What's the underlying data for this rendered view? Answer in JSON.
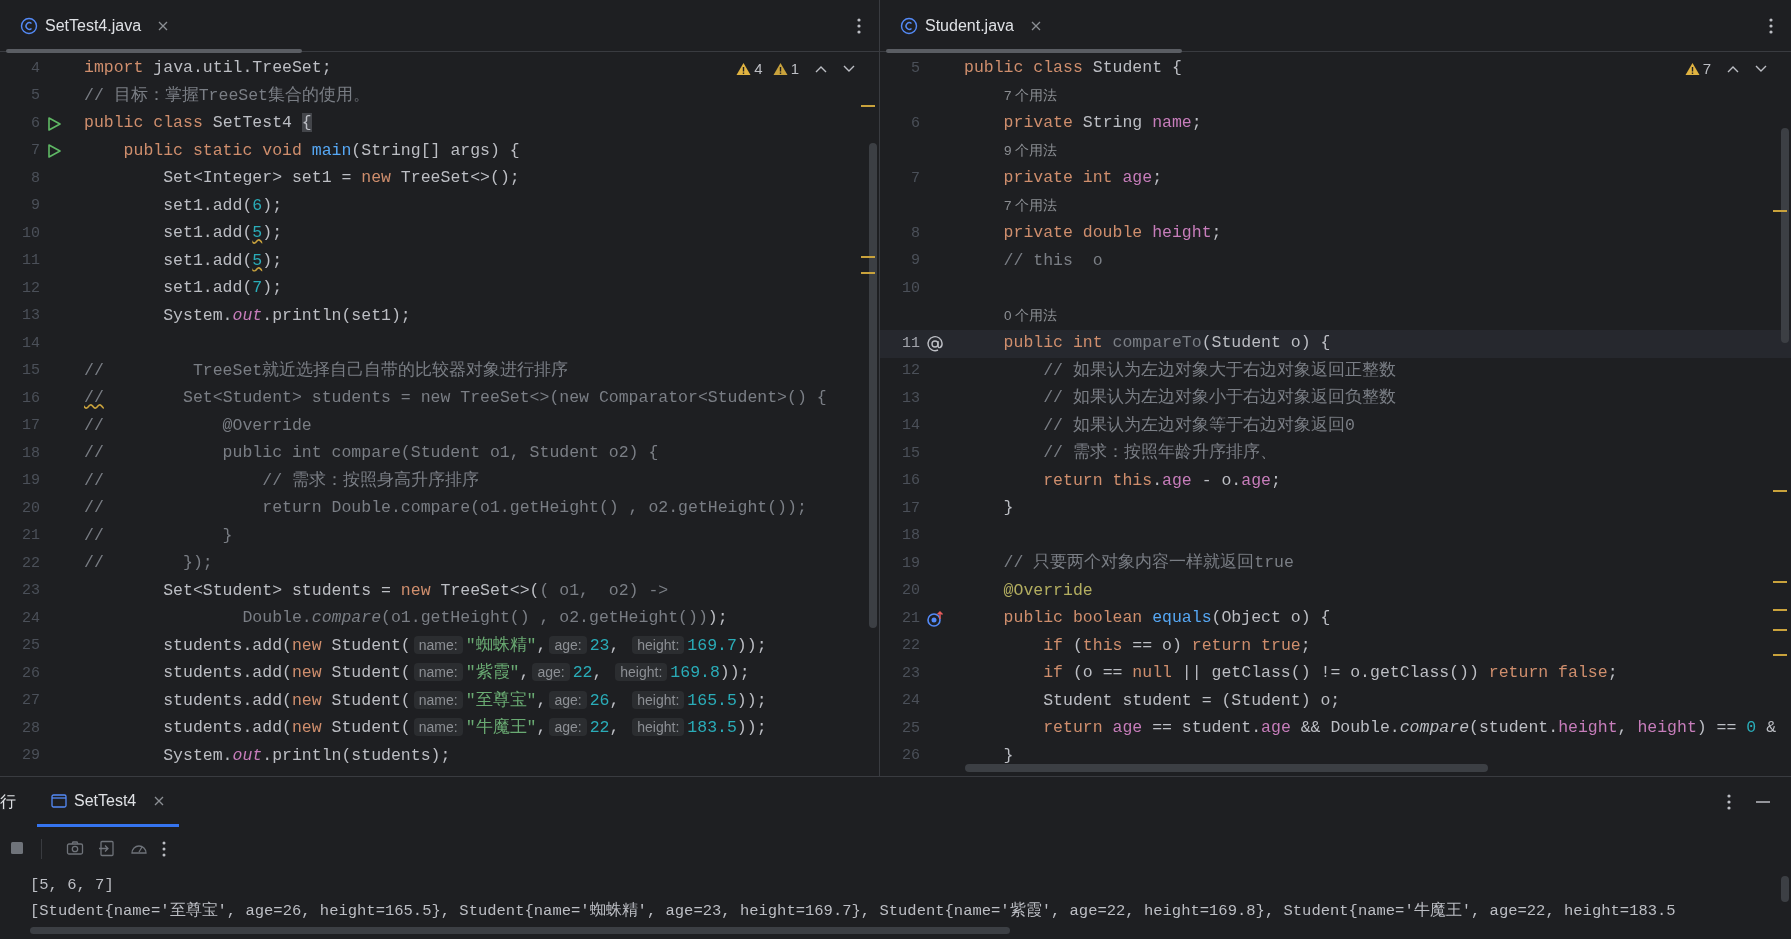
{
  "editors": [
    {
      "tab": {
        "title": "SetTest4.java",
        "selected": true
      },
      "problems": [
        {
          "kind": "warning",
          "count": "4"
        },
        {
          "kind": "weak",
          "count": "1"
        }
      ],
      "lines": [
        {
          "num": "4",
          "tokens": [
            {
              "text": "import",
              "kind": "kw"
            },
            {
              "text": " java.util.TreeSet;",
              "kind": "p"
            }
          ]
        },
        {
          "num": "5",
          "tokens": [
            {
              "text": "// 目标：掌握TreeSet集合的使用。",
              "kind": "cm"
            }
          ]
        },
        {
          "num": "6",
          "gutter_icon": {
            "kind": "run"
          },
          "tokens": [
            {
              "text": "public class",
              "kind": "kw"
            },
            {
              "text": " SetTest4 ",
              "kind": "p"
            },
            {
              "text": "{",
              "kind": "match"
            }
          ]
        },
        {
          "num": "7",
          "gutter_icon": {
            "kind": "run"
          },
          "tokens": [
            {
              "text": "    public static void ",
              "kind": "kw"
            },
            {
              "text": "main",
              "kind": "fn"
            },
            {
              "text": "(String[] args) {",
              "kind": "p"
            }
          ]
        },
        {
          "num": "8",
          "tokens": [
            {
              "text": "        Set<Integer> set1 = ",
              "kind": "p"
            },
            {
              "text": "new",
              "kind": "kw"
            },
            {
              "text": " TreeSet<>();",
              "kind": "p"
            }
          ]
        },
        {
          "num": "9",
          "tokens": [
            {
              "text": "        set1.add(",
              "kind": "p"
            },
            {
              "text": "6",
              "kind": "num"
            },
            {
              "text": ");",
              "kind": "p"
            }
          ]
        },
        {
          "num": "10",
          "tokens": [
            {
              "text": "        set1.add(",
              "kind": "p"
            },
            {
              "text": "5",
              "kind": "numwarn"
            },
            {
              "text": ");",
              "kind": "p"
            }
          ]
        },
        {
          "num": "11",
          "tokens": [
            {
              "text": "        set1.add(",
              "kind": "p"
            },
            {
              "text": "5",
              "kind": "numwarn"
            },
            {
              "text": ");",
              "kind": "p"
            }
          ]
        },
        {
          "num": "12",
          "tokens": [
            {
              "text": "        set1.add(",
              "kind": "p"
            },
            {
              "text": "7",
              "kind": "num"
            },
            {
              "text": ");",
              "kind": "p"
            }
          ]
        },
        {
          "num": "13",
          "tokens": [
            {
              "text": "        System.",
              "kind": "p"
            },
            {
              "text": "out",
              "kind": "st"
            },
            {
              "text": ".println(set1);",
              "kind": "p"
            }
          ]
        },
        {
          "num": "14"
        },
        {
          "num": "15",
          "tokens": [
            {
              "text": "//         TreeSet就近选择自己自带的比较器对象进行排序",
              "kind": "cm"
            }
          ]
        },
        {
          "num": "16",
          "tokens": [
            {
              "text": "//",
              "kind": "cmwarn"
            },
            {
              "text": "        Set<Student> students = new TreeSet<>(new Comparator<Student>() {",
              "kind": "cm"
            }
          ]
        },
        {
          "num": "17",
          "tokens": [
            {
              "text": "//            @Override",
              "kind": "cm"
            }
          ]
        },
        {
          "num": "18",
          "tokens": [
            {
              "text": "//            public int compare(Student o1, Student o2) {",
              "kind": "cm"
            }
          ]
        },
        {
          "num": "19",
          "tokens": [
            {
              "text": "//                // 需求：按照身高升序排序",
              "kind": "cm"
            }
          ]
        },
        {
          "num": "20",
          "tokens": [
            {
              "text": "//                return Double.compare(o1.getHeight() , o2.getHeight());",
              "kind": "cm"
            }
          ]
        },
        {
          "num": "21",
          "tokens": [
            {
              "text": "//            }",
              "kind": "cm"
            }
          ]
        },
        {
          "num": "22",
          "tokens": [
            {
              "text": "//        });",
              "kind": "cm"
            }
          ]
        },
        {
          "num": "23",
          "tokens": [
            {
              "text": "        Set<Student> students = ",
              "kind": "p"
            },
            {
              "text": "new",
              "kind": "kw"
            },
            {
              "text": " TreeSet<>(",
              "kind": "p"
            },
            {
              "text": "( o1,  o2) ->",
              "kind": "dim"
            }
          ]
        },
        {
          "num": "24",
          "tokens": [
            {
              "text": "                Double.",
              "kind": "dim"
            },
            {
              "text": "compare",
              "kind": "dimit"
            },
            {
              "text": "(o1.getHeight() , o2.getHeight())",
              "kind": "dim"
            },
            {
              "text": ");",
              "kind": "p"
            }
          ]
        },
        {
          "num": "25",
          "tokens": [
            {
              "text": "        students.add(",
              "kind": "p"
            },
            {
              "text": "new",
              "kind": "kw"
            },
            {
              "text": " Student(",
              "kind": "p"
            },
            {
              "text": "name:",
              "kind": "hint"
            },
            {
              "text": "\"蜘蛛精\"",
              "kind": "str"
            },
            {
              "text": ",",
              "kind": "p"
            },
            {
              "text": "age:",
              "kind": "hint"
            },
            {
              "text": "23",
              "kind": "num"
            },
            {
              "text": ", ",
              "kind": "p"
            },
            {
              "text": "height:",
              "kind": "hint"
            },
            {
              "text": "169.7",
              "kind": "num"
            },
            {
              "text": "));",
              "kind": "p"
            }
          ]
        },
        {
          "num": "26",
          "tokens": [
            {
              "text": "        students.add(",
              "kind": "p"
            },
            {
              "text": "new",
              "kind": "kw"
            },
            {
              "text": " Student(",
              "kind": "p"
            },
            {
              "text": "name:",
              "kind": "hint"
            },
            {
              "text": "\"紫霞\"",
              "kind": "str"
            },
            {
              "text": ",",
              "kind": "p"
            },
            {
              "text": "age:",
              "kind": "hint"
            },
            {
              "text": "22",
              "kind": "num"
            },
            {
              "text": ", ",
              "kind": "p"
            },
            {
              "text": "height:",
              "kind": "hint"
            },
            {
              "text": "169.8",
              "kind": "num"
            },
            {
              "text": "));",
              "kind": "p"
            }
          ]
        },
        {
          "num": "27",
          "tokens": [
            {
              "text": "        students.add(",
              "kind": "p"
            },
            {
              "text": "new",
              "kind": "kw"
            },
            {
              "text": " Student(",
              "kind": "p"
            },
            {
              "text": "name:",
              "kind": "hint"
            },
            {
              "text": "\"至尊宝\"",
              "kind": "str"
            },
            {
              "text": ",",
              "kind": "p"
            },
            {
              "text": "age:",
              "kind": "hint"
            },
            {
              "text": "26",
              "kind": "num"
            },
            {
              "text": ", ",
              "kind": "p"
            },
            {
              "text": "height:",
              "kind": "hint"
            },
            {
              "text": "165.5",
              "kind": "num"
            },
            {
              "text": "));",
              "kind": "p"
            }
          ]
        },
        {
          "num": "28",
          "tokens": [
            {
              "text": "        students.add(",
              "kind": "p"
            },
            {
              "text": "new",
              "kind": "kw"
            },
            {
              "text": " Student(",
              "kind": "p"
            },
            {
              "text": "name:",
              "kind": "hint"
            },
            {
              "text": "\"牛魔王\"",
              "kind": "str"
            },
            {
              "text": ",",
              "kind": "p"
            },
            {
              "text": "age:",
              "kind": "hint"
            },
            {
              "text": "22",
              "kind": "num"
            },
            {
              "text": ", ",
              "kind": "p"
            },
            {
              "text": "height:",
              "kind": "hint"
            },
            {
              "text": "183.5",
              "kind": "num"
            },
            {
              "text": "));",
              "kind": "p"
            }
          ]
        },
        {
          "num": "29",
          "tokens": [
            {
              "text": "        System.",
              "kind": "p"
            },
            {
              "text": "out",
              "kind": "st"
            },
            {
              "text": ".println(students);",
              "kind": "p"
            }
          ]
        }
      ]
    },
    {
      "tab": {
        "title": "Student.java",
        "selected": true
      },
      "problems": [
        {
          "kind": "warning",
          "count": "7"
        }
      ],
      "lines": [
        {
          "num": "5",
          "tokens": [
            {
              "text": "public class",
              "kind": "kw"
            },
            {
              "text": " Student {",
              "kind": "p"
            }
          ]
        },
        {
          "kind": "usages",
          "text": "7 个用法"
        },
        {
          "num": "6",
          "tokens": [
            {
              "text": "    private",
              "kind": "kw"
            },
            {
              "text": " String ",
              "kind": "p"
            },
            {
              "text": "name",
              "kind": "fld"
            },
            {
              "text": ";",
              "kind": "p"
            }
          ]
        },
        {
          "kind": "usages",
          "text": "9 个用法"
        },
        {
          "num": "7",
          "tokens": [
            {
              "text": "    private int ",
              "kind": "kw"
            },
            {
              "text": "age",
              "kind": "fld"
            },
            {
              "text": ";",
              "kind": "p"
            }
          ]
        },
        {
          "kind": "usages",
          "text": "7 个用法"
        },
        {
          "num": "8",
          "tokens": [
            {
              "text": "    private double ",
              "kind": "kw"
            },
            {
              "text": "height",
              "kind": "fld"
            },
            {
              "text": ";",
              "kind": "p"
            }
          ]
        },
        {
          "num": "9",
          "tokens": [
            {
              "text": "    // this  o",
              "kind": "cm"
            }
          ]
        },
        {
          "num": "10"
        },
        {
          "kind": "usages",
          "text": "0 个用法"
        },
        {
          "num": "11",
          "gutter_icon": {
            "kind": "implements"
          },
          "current": true,
          "tokens": [
            {
              "text": "    public int ",
              "kind": "kw"
            },
            {
              "text": "compareTo",
              "kind": "dim"
            },
            {
              "text": "(Student o) {",
              "kind": "p"
            }
          ]
        },
        {
          "num": "12",
          "tokens": [
            {
              "text": "        // 如果认为左边对象大于右边对象返回正整数",
              "kind": "cm"
            }
          ]
        },
        {
          "num": "13",
          "tokens": [
            {
              "text": "        // 如果认为左边对象小于右边对象返回负整数",
              "kind": "cm"
            }
          ]
        },
        {
          "num": "14",
          "tokens": [
            {
              "text": "        // 如果认为左边对象等于右边对象返回0",
              "kind": "cm"
            }
          ]
        },
        {
          "num": "15",
          "tokens": [
            {
              "text": "        // 需求：按照年龄升序排序、",
              "kind": "cm"
            }
          ]
        },
        {
          "num": "16",
          "tokens": [
            {
              "text": "        return this",
              "kind": "kw"
            },
            {
              "text": ".",
              "kind": "p"
            },
            {
              "text": "age",
              "kind": "fld"
            },
            {
              "text": " - o.",
              "kind": "p"
            },
            {
              "text": "age",
              "kind": "fld"
            },
            {
              "text": ";",
              "kind": "p"
            }
          ]
        },
        {
          "num": "17",
          "tokens": [
            {
              "text": "    }",
              "kind": "p"
            }
          ]
        },
        {
          "num": "18"
        },
        {
          "num": "19",
          "tokens": [
            {
              "text": "    // 只要两个对象内容一样就返回true",
              "kind": "cm"
            }
          ]
        },
        {
          "num": "20",
          "tokens": [
            {
              "text": "    @Override",
              "kind": "ann"
            }
          ]
        },
        {
          "num": "21",
          "gutter_icon": {
            "kind": "overrides"
          },
          "tokens": [
            {
              "text": "    public boolean ",
              "kind": "kw"
            },
            {
              "text": "equals",
              "kind": "fn"
            },
            {
              "text": "(Object o) {",
              "kind": "p"
            }
          ]
        },
        {
          "num": "22",
          "tokens": [
            {
              "text": "        if",
              "kind": "kw"
            },
            {
              "text": " (",
              "kind": "p"
            },
            {
              "text": "this",
              "kind": "kw"
            },
            {
              "text": " == o) ",
              "kind": "p"
            },
            {
              "text": "return true",
              "kind": "kw"
            },
            {
              "text": ";",
              "kind": "p"
            }
          ]
        },
        {
          "num": "23",
          "tokens": [
            {
              "text": "        if",
              "kind": "kw"
            },
            {
              "text": " (o == ",
              "kind": "p"
            },
            {
              "text": "null",
              "kind": "kw"
            },
            {
              "text": " || getClass() != o.getClass()) ",
              "kind": "p"
            },
            {
              "text": "return false",
              "kind": "kw"
            },
            {
              "text": ";",
              "kind": "p"
            }
          ]
        },
        {
          "num": "24",
          "tokens": [
            {
              "text": "        Student student = (Student) o;",
              "kind": "p"
            }
          ]
        },
        {
          "num": "25",
          "tokens": [
            {
              "text": "        return ",
              "kind": "kw"
            },
            {
              "text": "age",
              "kind": "fld"
            },
            {
              "text": " == student.",
              "kind": "p"
            },
            {
              "text": "age",
              "kind": "fld"
            },
            {
              "text": " && Double.",
              "kind": "p"
            },
            {
              "text": "compare",
              "kind": "it"
            },
            {
              "text": "(student.",
              "kind": "p"
            },
            {
              "text": "height",
              "kind": "fld"
            },
            {
              "text": ", ",
              "kind": "p"
            },
            {
              "text": "height",
              "kind": "fld"
            },
            {
              "text": ") == ",
              "kind": "p"
            },
            {
              "text": "0",
              "kind": "num"
            },
            {
              "text": " &",
              "kind": "p"
            }
          ]
        },
        {
          "num": "26",
          "tokens": [
            {
              "text": "    }",
              "kind": "p"
            }
          ]
        }
      ]
    }
  ],
  "run_panel": {
    "label": "行",
    "tabs": [
      {
        "title": "SetTest4",
        "selected": true
      }
    ],
    "output": [
      "[5, 6, 7]",
      "[Student{name='至尊宝', age=26, height=165.5}, Student{name='蜘蛛精', age=23, height=169.7}, Student{name='紫霞', age=22, height=169.8}, Student{name='牛魔王', age=22, height=183.5"
    ]
  }
}
